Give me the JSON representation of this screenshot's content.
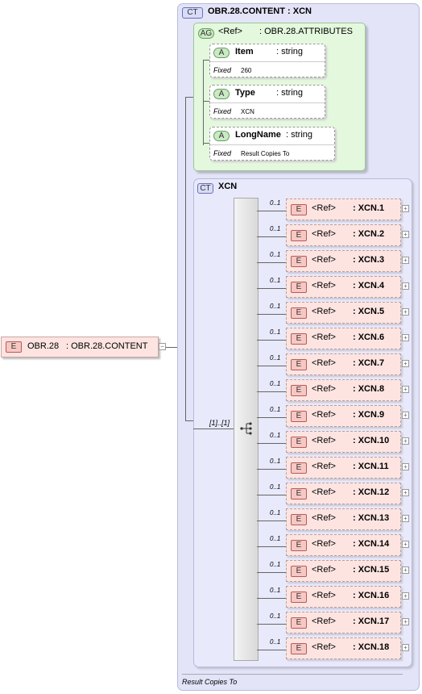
{
  "root": {
    "badge": "E",
    "name": "OBR.28",
    "type": ": OBR.28.CONTENT",
    "expander": "−"
  },
  "content_type": {
    "badge": "CT",
    "title": "OBR.28.CONTENT : XCN",
    "footer": "Result Copies To"
  },
  "attr_group": {
    "badge": "AG",
    "ref": "<Ref>",
    "type": ": OBR.28.ATTRIBUTES",
    "attributes": [
      {
        "badge": "A",
        "name": "Item",
        "type": ": string",
        "fixed_label": "Fixed",
        "fixed_value": "260"
      },
      {
        "badge": "A",
        "name": "Type",
        "type": ": string",
        "fixed_label": "Fixed",
        "fixed_value": "XCN"
      },
      {
        "badge": "A",
        "name": "LongName",
        "type": ": string",
        "fixed_label": "Fixed",
        "fixed_value": "Result Copies To"
      }
    ]
  },
  "xcn": {
    "badge": "CT",
    "title": "XCN",
    "sequence_card": "[1]..[1]",
    "elements": [
      {
        "card": "0..1",
        "badge": "E",
        "ref": "<Ref>",
        "type": ": XCN.1",
        "expander": "+"
      },
      {
        "card": "0..1",
        "badge": "E",
        "ref": "<Ref>",
        "type": ": XCN.2",
        "expander": "+"
      },
      {
        "card": "0..1",
        "badge": "E",
        "ref": "<Ref>",
        "type": ": XCN.3",
        "expander": "+"
      },
      {
        "card": "0..1",
        "badge": "E",
        "ref": "<Ref>",
        "type": ": XCN.4",
        "expander": "+"
      },
      {
        "card": "0..1",
        "badge": "E",
        "ref": "<Ref>",
        "type": ": XCN.5",
        "expander": "+"
      },
      {
        "card": "0..1",
        "badge": "E",
        "ref": "<Ref>",
        "type": ": XCN.6",
        "expander": "+"
      },
      {
        "card": "0..1",
        "badge": "E",
        "ref": "<Ref>",
        "type": ": XCN.7",
        "expander": "+"
      },
      {
        "card": "0..1",
        "badge": "E",
        "ref": "<Ref>",
        "type": ": XCN.8",
        "expander": "+"
      },
      {
        "card": "0..1",
        "badge": "E",
        "ref": "<Ref>",
        "type": ": XCN.9",
        "expander": "+"
      },
      {
        "card": "0..1",
        "badge": "E",
        "ref": "<Ref>",
        "type": ": XCN.10",
        "expander": "+"
      },
      {
        "card": "0..1",
        "badge": "E",
        "ref": "<Ref>",
        "type": ": XCN.11",
        "expander": "+"
      },
      {
        "card": "0..1",
        "badge": "E",
        "ref": "<Ref>",
        "type": ": XCN.12",
        "expander": "+"
      },
      {
        "card": "0..1",
        "badge": "E",
        "ref": "<Ref>",
        "type": ": XCN.13",
        "expander": "+"
      },
      {
        "card": "0..1",
        "badge": "E",
        "ref": "<Ref>",
        "type": ": XCN.14",
        "expander": "+"
      },
      {
        "card": "0..1",
        "badge": "E",
        "ref": "<Ref>",
        "type": ": XCN.15",
        "expander": "+"
      },
      {
        "card": "0..1",
        "badge": "E",
        "ref": "<Ref>",
        "type": ": XCN.16",
        "expander": "+"
      },
      {
        "card": "0..1",
        "badge": "E",
        "ref": "<Ref>",
        "type": ": XCN.17",
        "expander": "+"
      },
      {
        "card": "0..1",
        "badge": "E",
        "ref": "<Ref>",
        "type": ": XCN.18",
        "expander": "+"
      }
    ]
  },
  "colors": {
    "ct_panel": "#e3e4f8",
    "ag_panel": "#e4f8de",
    "element_box": "#fde4e1",
    "attr_box": "#ffffff"
  }
}
